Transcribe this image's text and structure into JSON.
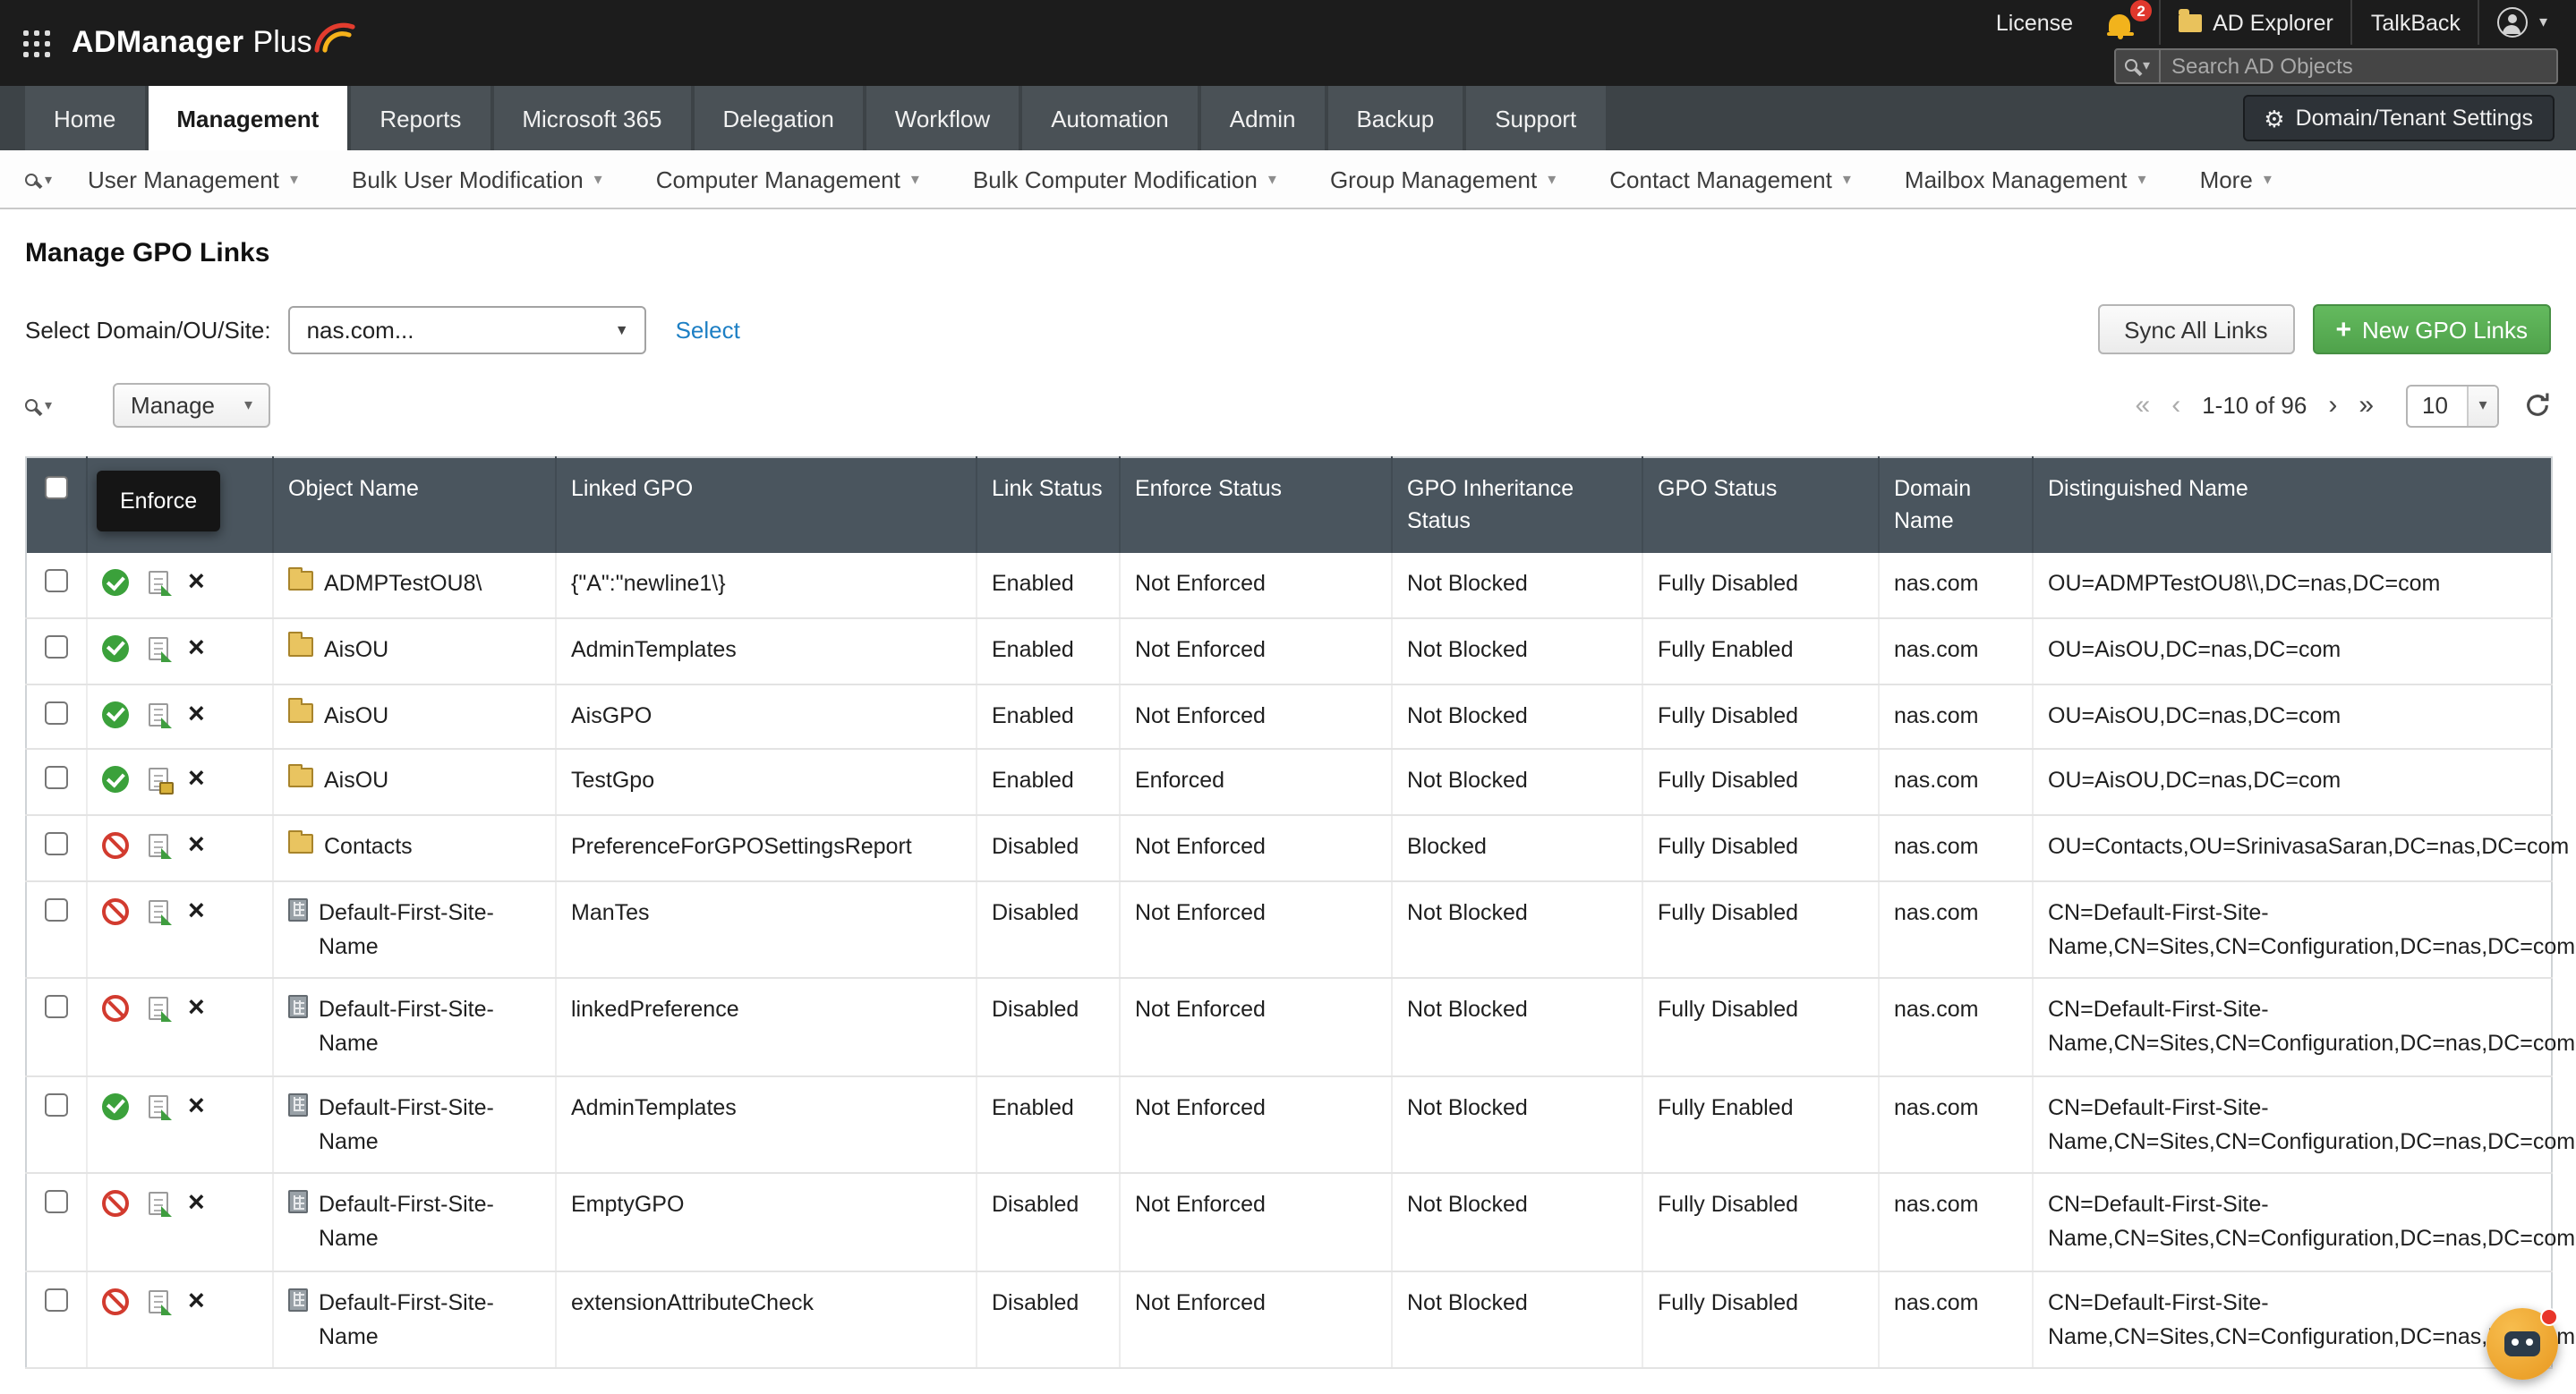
{
  "icons": {
    "caret_down": "▾",
    "caret_solid": "▼",
    "first_page": "«",
    "prev_page": "‹",
    "next_page": "›",
    "last_page": "»",
    "close": "×",
    "plus": "+",
    "gear": "⚙"
  },
  "colors": {
    "topbar_bg": "#1c1c1c",
    "nav_bg": "#3d4347",
    "active_tab_bg": "#ffffff",
    "table_header_bg": "#4a555e",
    "green_button": "#57a957",
    "link_blue": "#1d7fc4",
    "status_enabled_green": "#3ba13b",
    "status_disabled_red": "#d23b2f",
    "tooltip_bg": "#151515",
    "chat_orange": "#eda03a"
  },
  "topbar": {
    "brand_primary": "ADManager",
    "brand_secondary": "Plus",
    "license_label": "License",
    "notification_badge": "2",
    "ad_explorer_label": "AD Explorer",
    "talkback_label": "TalkBack",
    "search_placeholder": "Search AD Objects"
  },
  "nav": {
    "active_tab": "Management",
    "settings_button": "Domain/Tenant Settings",
    "tabs": [
      {
        "label": "Home"
      },
      {
        "label": "Management"
      },
      {
        "label": "Reports"
      },
      {
        "label": "Microsoft 365"
      },
      {
        "label": "Delegation"
      },
      {
        "label": "Workflow"
      },
      {
        "label": "Automation"
      },
      {
        "label": "Admin"
      },
      {
        "label": "Backup"
      },
      {
        "label": "Support"
      }
    ]
  },
  "menubar": {
    "items": [
      {
        "label": "User Management"
      },
      {
        "label": "Bulk User Modification"
      },
      {
        "label": "Computer Management"
      },
      {
        "label": "Bulk Computer Modification"
      },
      {
        "label": "Group Management"
      },
      {
        "label": "Contact Management"
      },
      {
        "label": "Mailbox Management"
      },
      {
        "label": "More"
      }
    ]
  },
  "page": {
    "title": "Manage GPO Links",
    "domain_label": "Select Domain/OU/Site:",
    "domain_value": "nas.com...",
    "select_link": "Select",
    "sync_button": "Sync All Links",
    "new_gpo_button": "New GPO Links"
  },
  "toolbar": {
    "manage_button": "Manage",
    "pagination_range": "1-10 of 96",
    "page_size": "10"
  },
  "tooltip": {
    "text": "Enforce"
  },
  "table": {
    "headers": {
      "object_name": "Object Name",
      "linked_gpo": "Linked GPO",
      "link_status": "Link Status",
      "enforce_status": "Enforce Status",
      "inheritance_status": "GPO Inheritance Status",
      "gpo_status": "GPO Status",
      "domain_name": "Domain Name",
      "distinguished_name": "Distinguished Name"
    },
    "rows": [
      {
        "object_type": "ou",
        "object_name": "ADMPTestOU8\\",
        "linked_gpo": "{\"A\":\"newline1\\}",
        "link_status": "Enabled",
        "enforce_status": "Not Enforced",
        "inheritance_status": "Not Blocked",
        "gpo_status": "Fully Disabled",
        "domain_name": "nas.com",
        "distinguished_name": "OU=ADMPTestOU8\\\\,DC=nas,DC=com"
      },
      {
        "object_type": "ou",
        "object_name": "AisOU",
        "linked_gpo": "AdminTemplates",
        "link_status": "Enabled",
        "enforce_status": "Not Enforced",
        "inheritance_status": "Not Blocked",
        "gpo_status": "Fully Enabled",
        "domain_name": "nas.com",
        "distinguished_name": "OU=AisOU,DC=nas,DC=com"
      },
      {
        "object_type": "ou",
        "object_name": "AisOU",
        "linked_gpo": "AisGPO",
        "link_status": "Enabled",
        "enforce_status": "Not Enforced",
        "inheritance_status": "Not Blocked",
        "gpo_status": "Fully Disabled",
        "domain_name": "nas.com",
        "distinguished_name": "OU=AisOU,DC=nas,DC=com"
      },
      {
        "object_type": "ou",
        "object_name": "AisOU",
        "linked_gpo": "TestGpo",
        "link_status": "Enabled",
        "enforce_status": "Enforced",
        "inheritance_status": "Not Blocked",
        "gpo_status": "Fully Disabled",
        "domain_name": "nas.com",
        "distinguished_name": "OU=AisOU,DC=nas,DC=com"
      },
      {
        "object_type": "ou",
        "object_name": "Contacts",
        "linked_gpo": "PreferenceForGPOSettingsReport",
        "link_status": "Disabled",
        "enforce_status": "Not Enforced",
        "inheritance_status": "Blocked",
        "gpo_status": "Fully Disabled",
        "domain_name": "nas.com",
        "distinguished_name": "OU=Contacts,OU=SrinivasaSaran,DC=nas,DC=com"
      },
      {
        "object_type": "site",
        "object_name": "Default-First-Site-Name",
        "linked_gpo": "ManTes",
        "link_status": "Disabled",
        "enforce_status": "Not Enforced",
        "inheritance_status": "Not Blocked",
        "gpo_status": "Fully Disabled",
        "domain_name": "nas.com",
        "distinguished_name": "CN=Default-First-Site-Name,CN=Sites,CN=Configuration,DC=nas,DC=com"
      },
      {
        "object_type": "site",
        "object_name": "Default-First-Site-Name",
        "linked_gpo": "linkedPreference",
        "link_status": "Disabled",
        "enforce_status": "Not Enforced",
        "inheritance_status": "Not Blocked",
        "gpo_status": "Fully Disabled",
        "domain_name": "nas.com",
        "distinguished_name": "CN=Default-First-Site-Name,CN=Sites,CN=Configuration,DC=nas,DC=com"
      },
      {
        "object_type": "site",
        "object_name": "Default-First-Site-Name",
        "linked_gpo": "AdminTemplates",
        "link_status": "Enabled",
        "enforce_status": "Not Enforced",
        "inheritance_status": "Not Blocked",
        "gpo_status": "Fully Enabled",
        "domain_name": "nas.com",
        "distinguished_name": "CN=Default-First-Site-Name,CN=Sites,CN=Configuration,DC=nas,DC=com"
      },
      {
        "object_type": "site",
        "object_name": "Default-First-Site-Name",
        "linked_gpo": "EmptyGPO",
        "link_status": "Disabled",
        "enforce_status": "Not Enforced",
        "inheritance_status": "Not Blocked",
        "gpo_status": "Fully Disabled",
        "domain_name": "nas.com",
        "distinguished_name": "CN=Default-First-Site-Name,CN=Sites,CN=Configuration,DC=nas,DC=com"
      },
      {
        "object_type": "site",
        "object_name": "Default-First-Site-Name",
        "linked_gpo": "extensionAttributeCheck",
        "link_status": "Disabled",
        "enforce_status": "Not Enforced",
        "inheritance_status": "Not Blocked",
        "gpo_status": "Fully Disabled",
        "domain_name": "nas.com",
        "distinguished_name": "CN=Default-First-Site-Name,CN=Sites,CN=Configuration,DC=nas,DC=com"
      }
    ]
  }
}
